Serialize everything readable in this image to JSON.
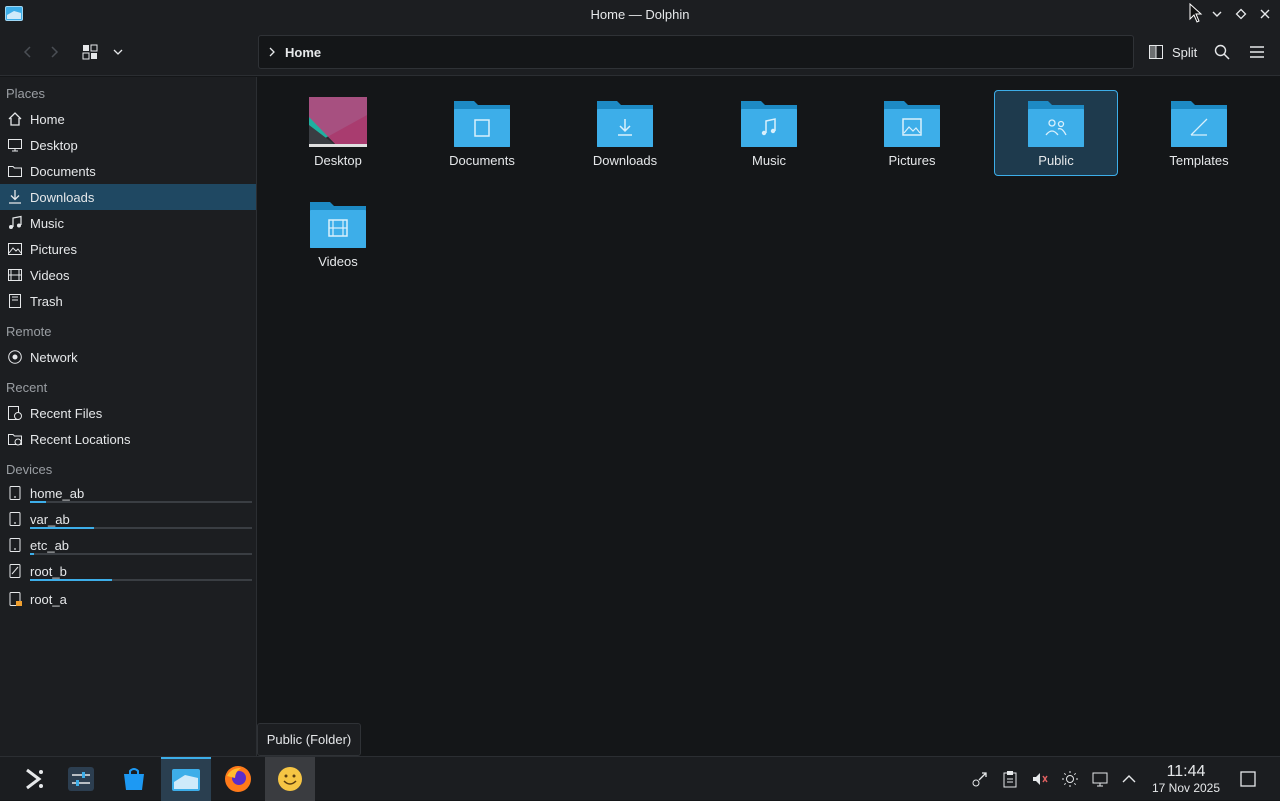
{
  "window": {
    "title": "Home — Dolphin"
  },
  "toolbar": {
    "breadcrumb": "Home",
    "split_label": "Split"
  },
  "sidebar": {
    "places_header": "Places",
    "places": [
      {
        "label": "Home",
        "icon": "home-icon"
      },
      {
        "label": "Desktop",
        "icon": "desktop-icon"
      },
      {
        "label": "Documents",
        "icon": "documents-icon"
      },
      {
        "label": "Downloads",
        "icon": "downloads-icon",
        "active": true
      },
      {
        "label": "Music",
        "icon": "music-icon"
      },
      {
        "label": "Pictures",
        "icon": "pictures-icon"
      },
      {
        "label": "Videos",
        "icon": "videos-icon"
      },
      {
        "label": "Trash",
        "icon": "trash-icon"
      }
    ],
    "remote_header": "Remote",
    "remote": [
      {
        "label": "Network",
        "icon": "network-icon"
      }
    ],
    "recent_header": "Recent",
    "recent": [
      {
        "label": "Recent Files",
        "icon": "recent-files-icon"
      },
      {
        "label": "Recent Locations",
        "icon": "recent-locations-icon"
      }
    ],
    "devices_header": "Devices",
    "devices": [
      {
        "label": "home_ab",
        "usage": 0.07
      },
      {
        "label": "var_ab",
        "usage": 0.29
      },
      {
        "label": "etc_ab",
        "usage": 0.02
      },
      {
        "label": "root_b",
        "usage": 0.37
      },
      {
        "label": "root_a"
      }
    ]
  },
  "files": [
    {
      "name": "Desktop",
      "icon": "desktop-folder-icon"
    },
    {
      "name": "Documents",
      "icon": "documents-folder-icon"
    },
    {
      "name": "Downloads",
      "icon": "downloads-folder-icon"
    },
    {
      "name": "Music",
      "icon": "music-folder-icon"
    },
    {
      "name": "Pictures",
      "icon": "pictures-folder-icon"
    },
    {
      "name": "Public",
      "icon": "public-folder-icon",
      "selected": true
    },
    {
      "name": "Templates",
      "icon": "templates-folder-icon"
    },
    {
      "name": "Videos",
      "icon": "videos-folder-icon"
    }
  ],
  "tooltip": "Public (Folder)",
  "taskbar": {
    "time": "11:44",
    "date": "17 Nov 2025"
  },
  "colors": {
    "accent": "#3daee9",
    "folder": "#3daee9",
    "selection": "#1f4862"
  }
}
